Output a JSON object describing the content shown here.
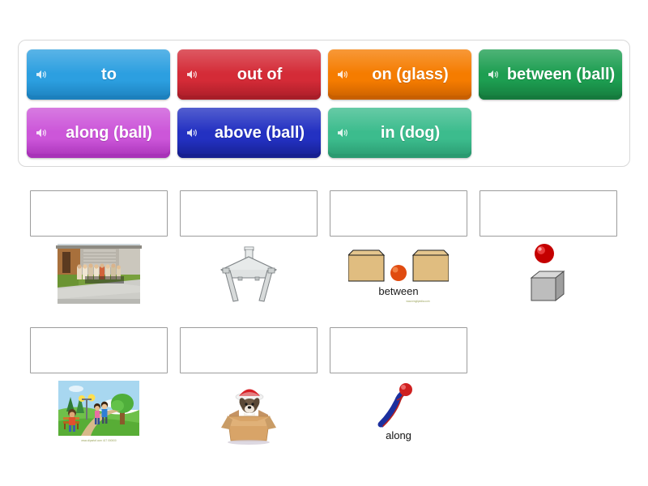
{
  "app": {
    "type": "match-up-drag-and-drop-activity",
    "background": "#ffffff"
  },
  "wordbank": {
    "name": "word-bank",
    "tiles": [
      {
        "label": "to",
        "color": "#2c9fe0",
        "shadow": "#1c80bd",
        "icon": "speaker-icon"
      },
      {
        "label": "out of",
        "color": "#d42b37",
        "shadow": "#a81d28",
        "icon": "speaker-icon"
      },
      {
        "label": "on (glass)",
        "color": "#f57c00",
        "shadow": "#c85f00",
        "icon": "speaker-icon"
      },
      {
        "label": "between (ball)",
        "color": "#1d9e51",
        "shadow": "#157a3d",
        "icon": "speaker-icon"
      },
      {
        "label": "along (ball)",
        "color": "#cc56d9",
        "shadow": "#a832b8",
        "icon": "speaker-icon"
      },
      {
        "label": "above (ball)",
        "color": "#2331c2",
        "shadow": "#161f90",
        "icon": "speaker-icon"
      },
      {
        "label": "in (dog)",
        "color": "#3cbc8d",
        "shadow": "#2a9a70",
        "icon": "speaker-icon"
      }
    ]
  },
  "answers": {
    "name": "answer-grid",
    "dropzone_placeholder": "",
    "items": [
      {
        "slot_label": "",
        "image_name": "photo-group-of-people-in-front-of-building",
        "image_caption": "",
        "image_type": "photo"
      },
      {
        "slot_label": "",
        "image_name": "glass-table-with-glass-on-top",
        "image_caption": "",
        "image_type": "clipart"
      },
      {
        "slot_label": "",
        "image_name": "ball-between-two-boxes",
        "image_caption": "between",
        "image_watermark": "www.englipedia.com",
        "image_type": "clipart"
      },
      {
        "slot_label": "",
        "image_name": "red-ball-above-gray-cube",
        "image_caption": "",
        "image_type": "clipart"
      },
      {
        "slot_label": "",
        "image_name": "children-walking-along-park-path",
        "image_caption": "",
        "image_watermark": "www.clipartof.com  417 000000",
        "image_type": "clipart"
      },
      {
        "slot_label": "",
        "image_name": "dog-in-cardboard-box",
        "image_caption": "",
        "image_type": "photo"
      },
      {
        "slot_label": "",
        "image_name": "ball-moving-along-curved-path",
        "image_caption": "along",
        "image_type": "clipart"
      }
    ]
  }
}
